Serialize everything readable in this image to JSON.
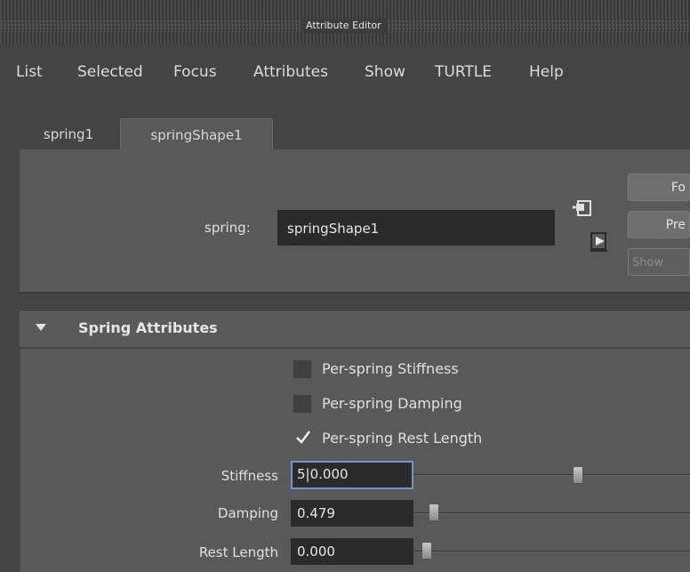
{
  "window": {
    "title": "Attribute Editor"
  },
  "menu": [
    "List",
    "Selected",
    "Focus",
    "Attributes",
    "Show",
    "TURTLE",
    "Help"
  ],
  "tabs": [
    {
      "label": "spring1",
      "active": false
    },
    {
      "label": "springShape1",
      "active": true
    }
  ],
  "node": {
    "label": "spring:",
    "value": "springShape1"
  },
  "side_buttons": [
    {
      "label": "Fo",
      "enabled": true
    },
    {
      "label": "Pre",
      "enabled": true
    },
    {
      "label": "Show",
      "enabled": false
    }
  ],
  "section": {
    "title": "Spring Attributes",
    "expanded": true,
    "checkboxes": [
      {
        "label": "Per-spring Stiffness",
        "checked": false
      },
      {
        "label": "Per-spring Damping",
        "checked": false
      },
      {
        "label": "Per-spring Rest Length",
        "checked": true
      }
    ],
    "attributes": [
      {
        "label": "Stiffness",
        "value": "5|0.000",
        "focused": true
      },
      {
        "label": "Damping",
        "value": "0.479",
        "focused": false
      },
      {
        "label": "Rest Length",
        "value": "0.000",
        "focused": false
      }
    ]
  },
  "icons": [
    "select-node-icon",
    "load-node-icon",
    "collapse-arrow-icon",
    "checkmark-icon"
  ],
  "colors": {
    "focus_border": "#6f96c6",
    "field_bg": "#2b2b2b",
    "panel_bg": "#595959"
  }
}
